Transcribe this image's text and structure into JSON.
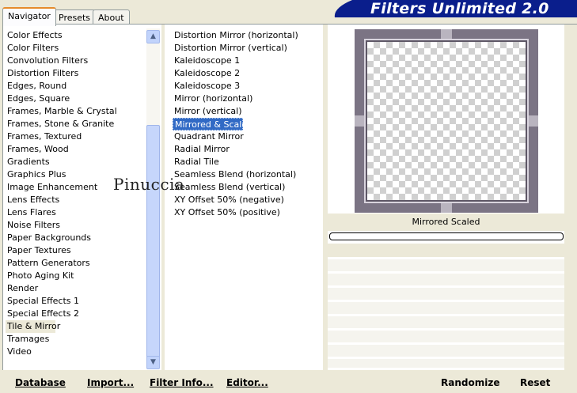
{
  "tabs": [
    "Navigator",
    "Presets",
    "About"
  ],
  "banner_title": "Filters Unlimited 2.0",
  "categories": [
    "Color Effects",
    "Color Filters",
    "Convolution Filters",
    "Distortion Filters",
    "Edges, Round",
    "Edges, Square",
    "Frames, Marble & Crystal",
    "Frames, Stone & Granite",
    "Frames, Textured",
    "Frames, Wood",
    "Gradients",
    "Graphics Plus",
    "Image Enhancement",
    "Lens Effects",
    "Lens Flares",
    "Noise Filters",
    "Paper Backgrounds",
    "Paper Textures",
    "Pattern Generators",
    "Photo Aging Kit",
    "Render",
    "Special Effects 1",
    "Special Effects 2",
    "Tile & Mirror",
    "Tramages",
    "Video"
  ],
  "selected_category": "Tile & Mirror",
  "filters": [
    "Distortion Mirror (horizontal)",
    "Distortion Mirror (vertical)",
    "Kaleidoscope 1",
    "Kaleidoscope 2",
    "Kaleidoscope 3",
    "Mirror (horizontal)",
    "Mirror (vertical)",
    "Mirrored & Scaled",
    "Quadrant Mirror",
    "Radial Mirror",
    "Radial Tile",
    "Seamless Blend (horizontal)",
    "Seamless Blend (vertical)",
    "XY Offset 50% (negative)",
    "XY Offset 50% (positive)"
  ],
  "selected_filter": "Mirrored & Scaled",
  "preview_filter_name": "Mirrored  Scaled",
  "progress_fraction": 0,
  "watermark": "Pinuccia",
  "buttons": {
    "database": "Database",
    "import": "Import...",
    "filter_info": "Filter Info...",
    "editor": "Editor...",
    "randomize": "Randomize",
    "reset": "Reset"
  },
  "colors": {
    "banner_bg": "#0a1e8c",
    "selection_bg": "#316ac5",
    "progress_fill": "#2b9a2b"
  }
}
